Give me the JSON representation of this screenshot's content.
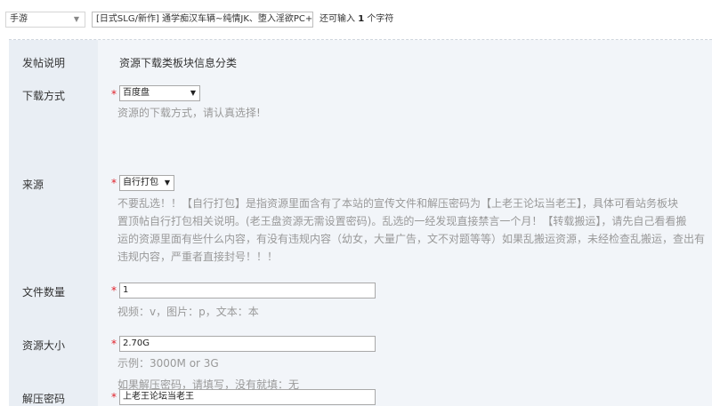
{
  "topbar": {
    "type_select": "手游",
    "title_value": "[日式SLG/新作] 通学痴汉车辆~纯情JK、堕入淫欲PC+安",
    "char_hint_prefix": "还可输入",
    "char_hint_count": "1",
    "char_hint_suffix": "个字符"
  },
  "form": {
    "header": {
      "label": "发帖说明",
      "text": "资源下载类板块信息分类"
    },
    "download": {
      "label": "下载方式",
      "required": "*",
      "selected": "百度盘",
      "help": "资源的下载方式，请认真选择!"
    },
    "source": {
      "label": "来源",
      "required": "*",
      "selected": "自行打包",
      "help_lines": [
        "不要乱选！！【自行打包】是指资源里面含有了本站的宣传文件和解压密码为【上老王论坛当老王】，具体可看站务板块",
        "置顶帖自行打包相关说明。(老王盘资源无需设置密码)。乱选的一经发现直接禁言一个月！【转载搬运】，请先自己看看搬",
        "运的资源里面有些什么内容，有没有违规内容（幼女，大量广告，文不对题等等）如果乱搬运资源，未经检查乱搬运，查出有",
        "违规内容，严重者直接封号！！！"
      ]
    },
    "file_count": {
      "label": "文件数量",
      "required": "*",
      "value": "1",
      "help": "视频：v，图片：p，文本：本"
    },
    "size": {
      "label": "资源大小",
      "required": "*",
      "value": "2.70G",
      "help": "示例：3000M or 3G"
    },
    "password": {
      "label": "解压密码",
      "required": "*",
      "value": "上老王论坛当老王",
      "help": "如果解压密码，请填写，没有就填：无"
    }
  }
}
